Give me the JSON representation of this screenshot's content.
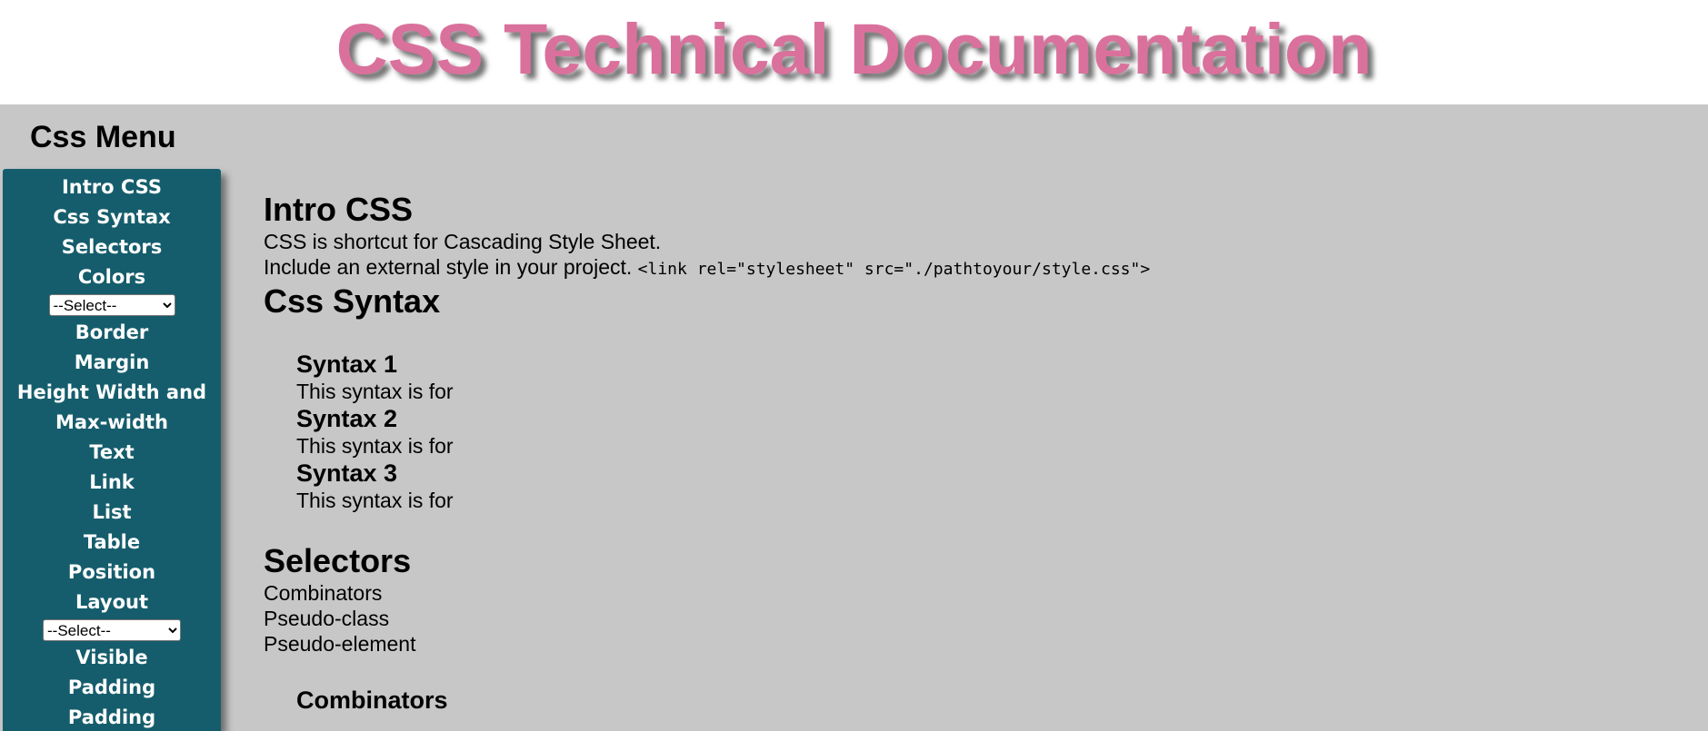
{
  "header": {
    "title": "CSS Technical Documentation"
  },
  "sidebar": {
    "title": "Css Menu",
    "items_top": [
      "Intro CSS",
      "Css Syntax",
      "Selectors",
      "Colors"
    ],
    "select_1": {
      "value": "--Select--"
    },
    "items_mid": [
      "Border",
      "Margin",
      "Height Width and",
      "Max-width",
      "Text",
      "Link",
      "List",
      "Table",
      "Position",
      "Layout"
    ],
    "select_2": {
      "value": "--Select--"
    },
    "items_bottom": [
      "Visible",
      "Padding",
      "Padding"
    ]
  },
  "main": {
    "intro": {
      "heading": "Intro CSS",
      "line1": "CSS is shortcut for Cascading Style Sheet.",
      "line2_text": "Include an external style in your project.",
      "line2_code": "<link rel=\"stylesheet\" src=\"./pathtoyour/style.css\">"
    },
    "syntax": {
      "heading": "Css Syntax",
      "items": [
        {
          "title": "Syntax 1",
          "text": "This syntax is for"
        },
        {
          "title": "Syntax 2",
          "text": "This syntax is for"
        },
        {
          "title": "Syntax 3",
          "text": "This syntax is for"
        }
      ]
    },
    "selectors": {
      "heading": "Selectors",
      "list": [
        "Combinators",
        "Pseudo-class",
        "Pseudo-element"
      ],
      "sub_heading": "Combinators"
    }
  },
  "colors": {
    "title": "#d9719c",
    "sidebar_bg": "#155d6c",
    "page_bg": "#c7c7c7"
  }
}
